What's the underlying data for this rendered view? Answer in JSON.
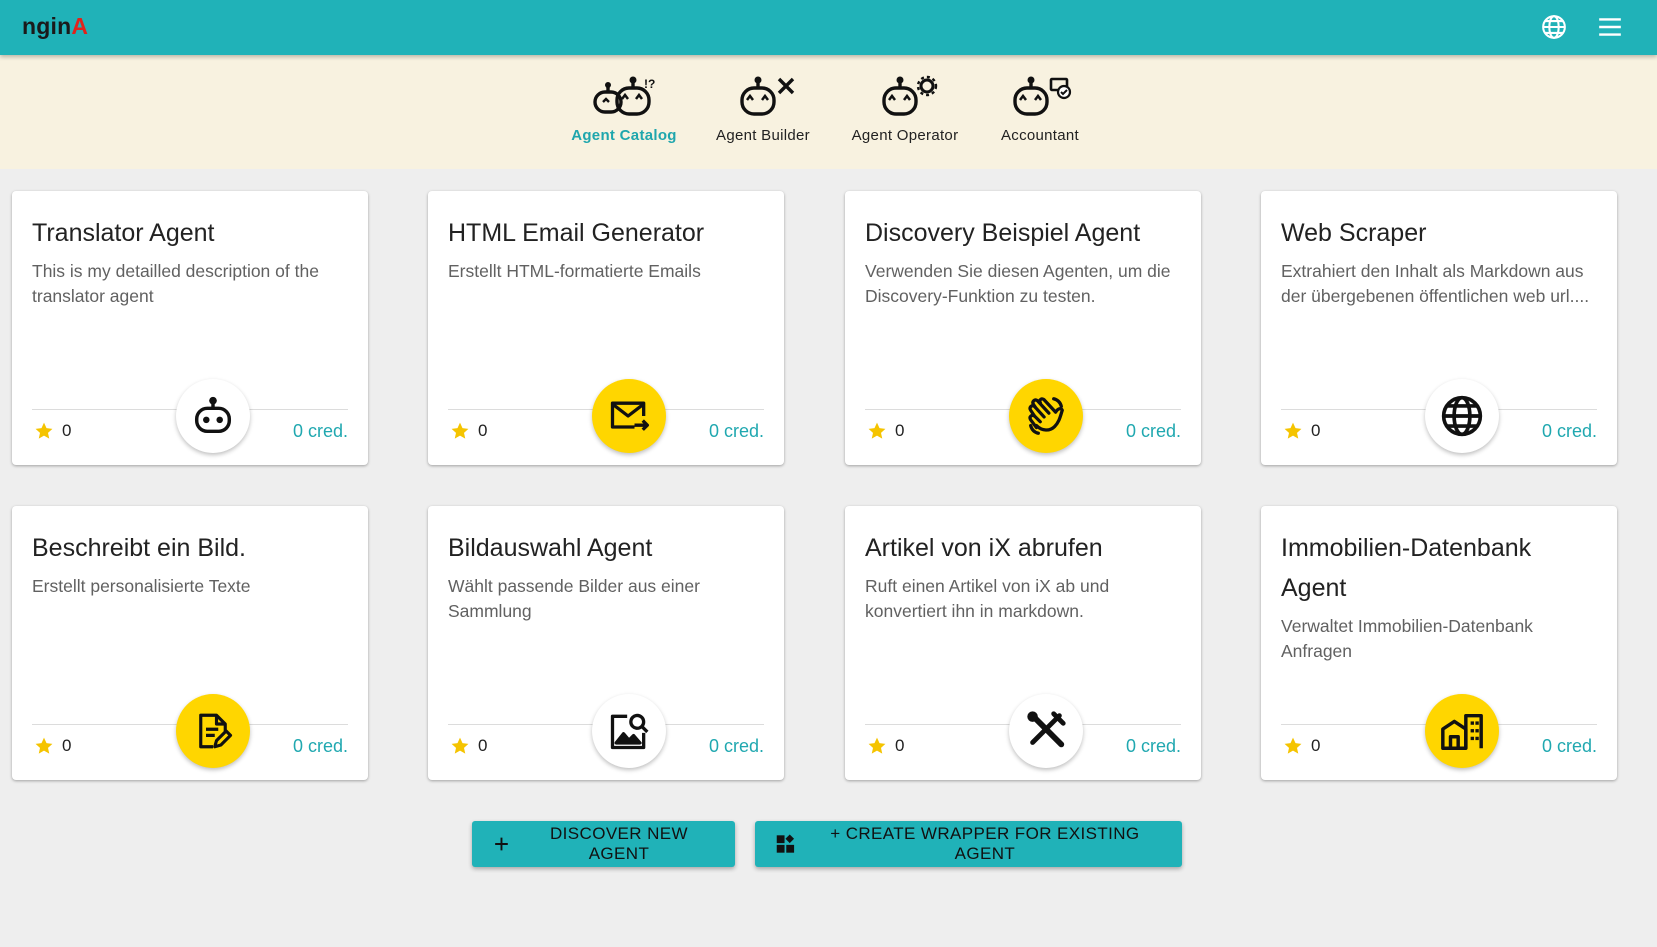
{
  "app": {
    "logo_main": "ngin",
    "logo_accent": "A",
    "accent_color": "#20b2b8",
    "logo_accent_color": "#e0231c"
  },
  "topbar": {
    "icons": [
      "globe-icon",
      "menu-icon"
    ]
  },
  "nav": {
    "items": [
      {
        "label": "Agent Catalog",
        "icon": "robot-catalog-icon",
        "active": true
      },
      {
        "label": "Agent Builder",
        "icon": "robot-builder-icon",
        "active": false
      },
      {
        "label": "Agent Operator",
        "icon": "robot-operator-icon",
        "active": false
      },
      {
        "label": "Accountant",
        "icon": "robot-accountant-icon",
        "active": false
      }
    ]
  },
  "cards": [
    {
      "title": "Translator Agent",
      "description": "This is my detailled description of the translator agent",
      "rating": "0",
      "credits": "0 cred.",
      "icon": "robot-icon",
      "badge_color": "white"
    },
    {
      "title": "HTML Email Generator",
      "description": "Erstellt HTML-formatierte Emails",
      "rating": "0",
      "credits": "0 cred.",
      "icon": "email-send-icon",
      "badge_color": "yellow"
    },
    {
      "title": "Discovery Beispiel Agent",
      "description": "Verwenden Sie diesen Agenten, um die Discovery-Funktion zu testen.",
      "rating": "0",
      "credits": "0 cred.",
      "icon": "waving-hand-icon",
      "badge_color": "yellow"
    },
    {
      "title": "Web Scraper",
      "description": "Extrahiert den Inhalt als Markdown aus der übergebenen öffentlichen web url....",
      "rating": "0",
      "credits": "0 cred.",
      "icon": "globe-icon",
      "badge_color": "white"
    },
    {
      "title": "Beschreibt ein Bild.",
      "description": "Erstellt personalisierte Texte",
      "rating": "0",
      "credits": "0 cred.",
      "icon": "edit-document-icon",
      "badge_color": "yellow"
    },
    {
      "title": "Bildauswahl Agent",
      "description": "Wählt passende Bilder aus einer Sammlung",
      "rating": "0",
      "credits": "0 cred.",
      "icon": "image-search-icon",
      "badge_color": "white"
    },
    {
      "title": "Artikel von iX abrufen",
      "description": "Ruft einen Artikel von iX ab und konvertiert ihn in markdown.",
      "rating": "0",
      "credits": "0 cred.",
      "icon": "tools-icon",
      "badge_color": "white"
    },
    {
      "title": "Immobilien-Datenbank Agent",
      "description": "Verwaltet Immobilien-Datenbank Anfragen",
      "rating": "0",
      "credits": "0 cred.",
      "icon": "building-icon",
      "badge_color": "yellow"
    }
  ],
  "actions": {
    "discover_label": "DISCOVER NEW AGENT",
    "wrapper_label": "+ CREATE WRAPPER FOR EXISTING AGENT"
  }
}
